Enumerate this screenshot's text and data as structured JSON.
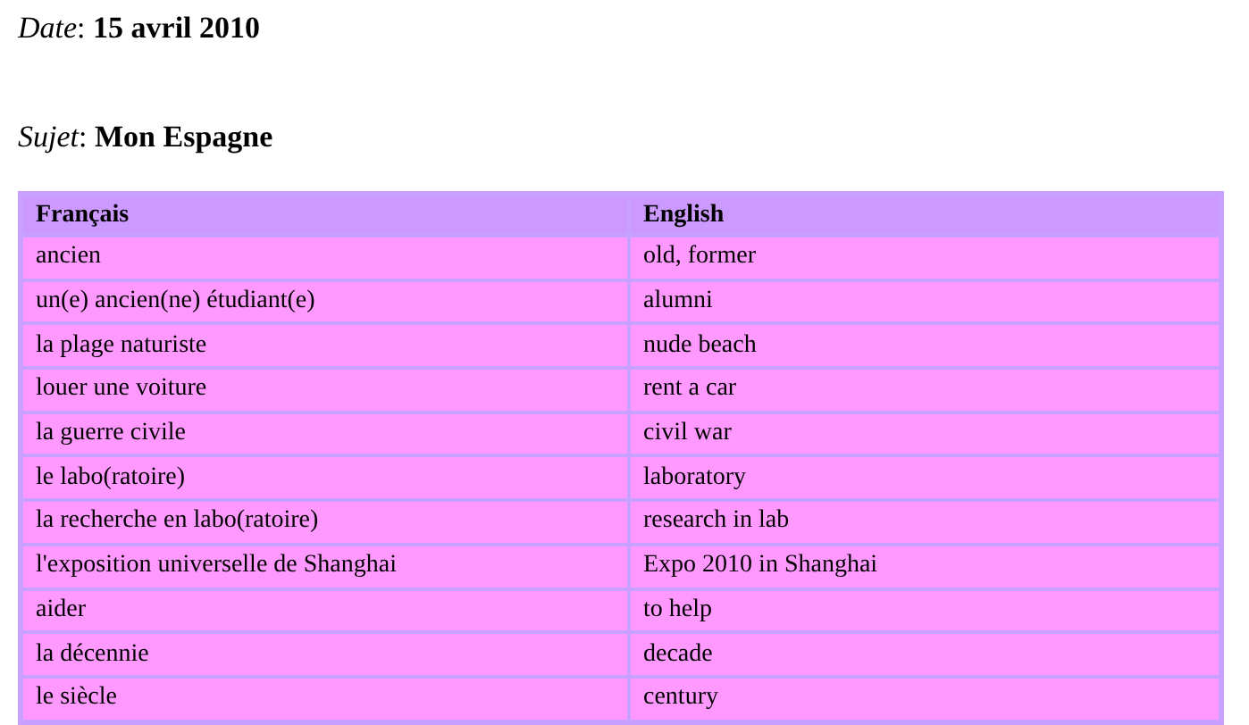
{
  "fields": [
    {
      "text": "*Date*: **15 avril 2010**"
    },
    {
      "text": "*Sujet*: **Mon Espagne**"
    }
  ],
  "table": {
    "columns": [
      "Français",
      "English"
    ],
    "rows": [
      [
        "ancien",
        "old, former"
      ],
      [
        "un(e) ancien(ne) étudiant(e)",
        "alumni"
      ],
      [
        "la plage naturiste",
        "nude beach"
      ],
      [
        "louer une voiture",
        "rent a car"
      ],
      [
        "la guerre civile",
        "civil war"
      ],
      [
        "le labo(ratoire)",
        "laboratory"
      ],
      [
        "la recherche en labo(ratoire)",
        "research in lab"
      ],
      [
        "l'exposition universelle de Shanghai",
        "Expo 2010 in Shanghai"
      ],
      [
        "aider",
        "to help"
      ],
      [
        "la décennie",
        "decade"
      ],
      [
        "le siècle",
        "century"
      ]
    ]
  }
}
